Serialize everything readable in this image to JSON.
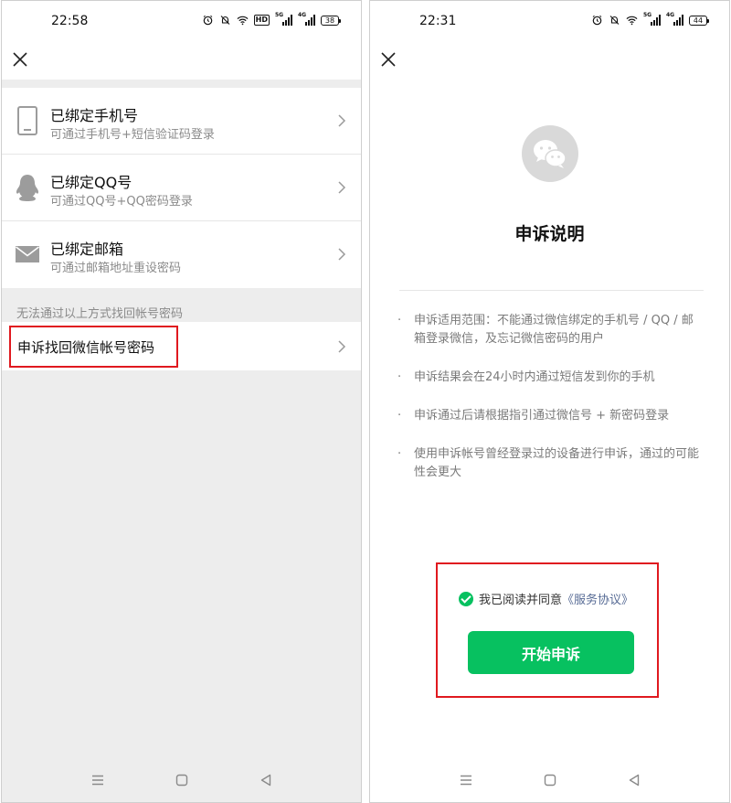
{
  "left": {
    "status": {
      "time": "22:58",
      "battery": "38"
    },
    "bound": [
      {
        "title": "已绑定手机号",
        "sub": "可通过手机号+短信验证码登录",
        "icon": "phone-icon"
      },
      {
        "title": "已绑定QQ号",
        "sub": "可通过QQ号+QQ密码登录",
        "icon": "qq-penguin-icon"
      },
      {
        "title": "已绑定邮箱",
        "sub": "可通过邮箱地址重设密码",
        "icon": "mail-icon"
      }
    ],
    "section_label": "无法通过以上方式找回帐号密码",
    "appeal_label": "申诉找回微信帐号密码"
  },
  "right": {
    "status": {
      "time": "22:31",
      "battery": "44"
    },
    "title": "申诉说明",
    "bullets": [
      "申诉适用范围：不能通过微信绑定的手机号 / QQ / 邮箱登录微信，及忘记微信密码的用户",
      "申诉结果会在24小时内通过短信发到你的手机",
      "申诉通过后请根据指引通过微信号 + 新密码登录",
      "使用申诉帐号曾经登录过的设备进行申诉，通过的可能性会更大"
    ],
    "agree_text": "我已阅读并同意",
    "agree_link": "《服务协议》",
    "start_button": "开始申诉"
  },
  "status_labels": {
    "hd": "HD",
    "net5g": "5G",
    "net4g": "4G"
  },
  "colors": {
    "accent": "#07c160",
    "link": "#576b95",
    "highlight": "#e0191f"
  },
  "icons": [
    "close-icon",
    "chevron-right-icon",
    "phone-icon",
    "qq-penguin-icon",
    "mail-icon",
    "wechat-logo-icon",
    "check-circle-icon",
    "menu-icon",
    "home-icon",
    "back-icon",
    "alarm-icon",
    "mute-icon",
    "wifi-icon"
  ]
}
